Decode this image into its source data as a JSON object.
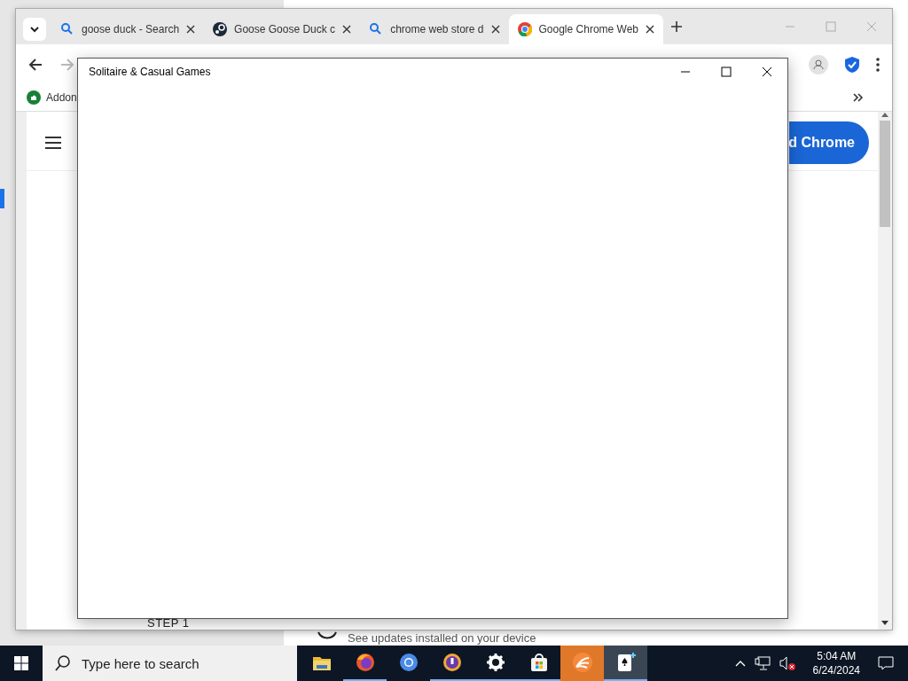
{
  "settings_window": {
    "update_text": "See updates installed on your device"
  },
  "browser": {
    "tabs": [
      {
        "kind": "search",
        "title": "goose duck - Search",
        "selected": false
      },
      {
        "kind": "steam",
        "title": "Goose Goose Duck c",
        "selected": false
      },
      {
        "kind": "search",
        "title": "chrome web store d",
        "selected": false
      },
      {
        "kind": "chrome",
        "title": "Google Chrome Web",
        "selected": true
      }
    ],
    "bookmarks": [
      {
        "label": "Addon"
      }
    ],
    "page": {
      "button": "d Chrome",
      "step": "STEP 1"
    }
  },
  "app_window": {
    "title": "Solitaire & Casual Games"
  },
  "taskbar": {
    "search": {
      "placeholder": "Type here to search"
    },
    "apps": [
      {
        "kind": "explorer",
        "running": false,
        "selected": false
      },
      {
        "kind": "firefox",
        "running": true,
        "selected": false
      },
      {
        "kind": "chromium",
        "running": false,
        "selected": false
      },
      {
        "kind": "shield-browser",
        "running": true,
        "selected": false
      },
      {
        "kind": "settings",
        "running": true,
        "selected": false
      },
      {
        "kind": "store",
        "running": true,
        "selected": false
      },
      {
        "kind": "orange-app",
        "running": false,
        "selected": false
      },
      {
        "kind": "solitaire",
        "running": true,
        "selected": true
      }
    ],
    "time": "5:04 AM",
    "date": "6/24/2024"
  }
}
